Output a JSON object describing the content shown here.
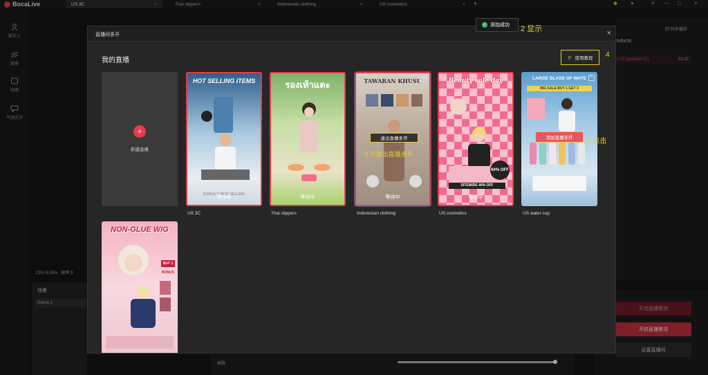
{
  "app": {
    "name": "BocaLive"
  },
  "tabs": [
    {
      "label": "US 3C"
    },
    {
      "label": "Thai slippers"
    },
    {
      "label": "Indonesian clothing"
    },
    {
      "label": "US cosmetics"
    }
  ],
  "sidebar": {
    "items": [
      {
        "label": "数字人"
      },
      {
        "label": "背景"
      },
      {
        "label": "贴图"
      },
      {
        "label": "气泡文字"
      }
    ]
  },
  "background": {
    "cpu": "CPU 6.55%",
    "frame": "帧率 3",
    "scene_title": "场景",
    "scene_item": "Scene 1",
    "right_top": "回 同步播放",
    "right_products": "roducts",
    "right_row": "n 3C products (1)",
    "right_row_time": "01:32",
    "btn_start_live": "开启直播推流",
    "btn_start_push": "开启直播推流",
    "btn_settings": "设置直播间",
    "bottom_label": "典题"
  },
  "modal": {
    "title": "直播间多开",
    "section_title": "我的直播",
    "tutorial_label": "使用教程",
    "new_live_label": "新建直播",
    "waiting": "等待中",
    "exit_multi": "退出直播多开",
    "join_multi": "添加直播多开",
    "cards": [
      {
        "label": "US 3C",
        "thumb_title": "HOT SELLING ITEMS",
        "thumb_sub": "BONUS D BEST SELLING"
      },
      {
        "label": "Thai slippers",
        "thumb_title": "รองเท้าแตะ"
      },
      {
        "label": "Indonesian clothing",
        "thumb_title": "TAWARAN KHUSU"
      },
      {
        "label": "US cosmetics",
        "thumb_title": "Beauty sale day",
        "thumb_badge": "60% OFF",
        "thumb_sub": "SITEWIDE 40% OFF"
      },
      {
        "label": "US water cup",
        "thumb_title": "LARGE GLASS OF WATE",
        "thumb_sub": "BIG SALE BUY 1 GET 3"
      },
      {
        "label": "",
        "thumb_title": "NON-GLUE WIG",
        "thumb_badge": "BUY 1",
        "thumb_sub": "BONUS"
      }
    ]
  },
  "toast": {
    "text": "添加成功"
  },
  "annotations": {
    "a1": "1 点击",
    "a2": "2 显示",
    "a3": "3 可退出直播多开",
    "a4": "4"
  },
  "colors": {
    "accent": "#e83b4c",
    "highlight": "#e5d02a",
    "success": "#2ec16b"
  }
}
